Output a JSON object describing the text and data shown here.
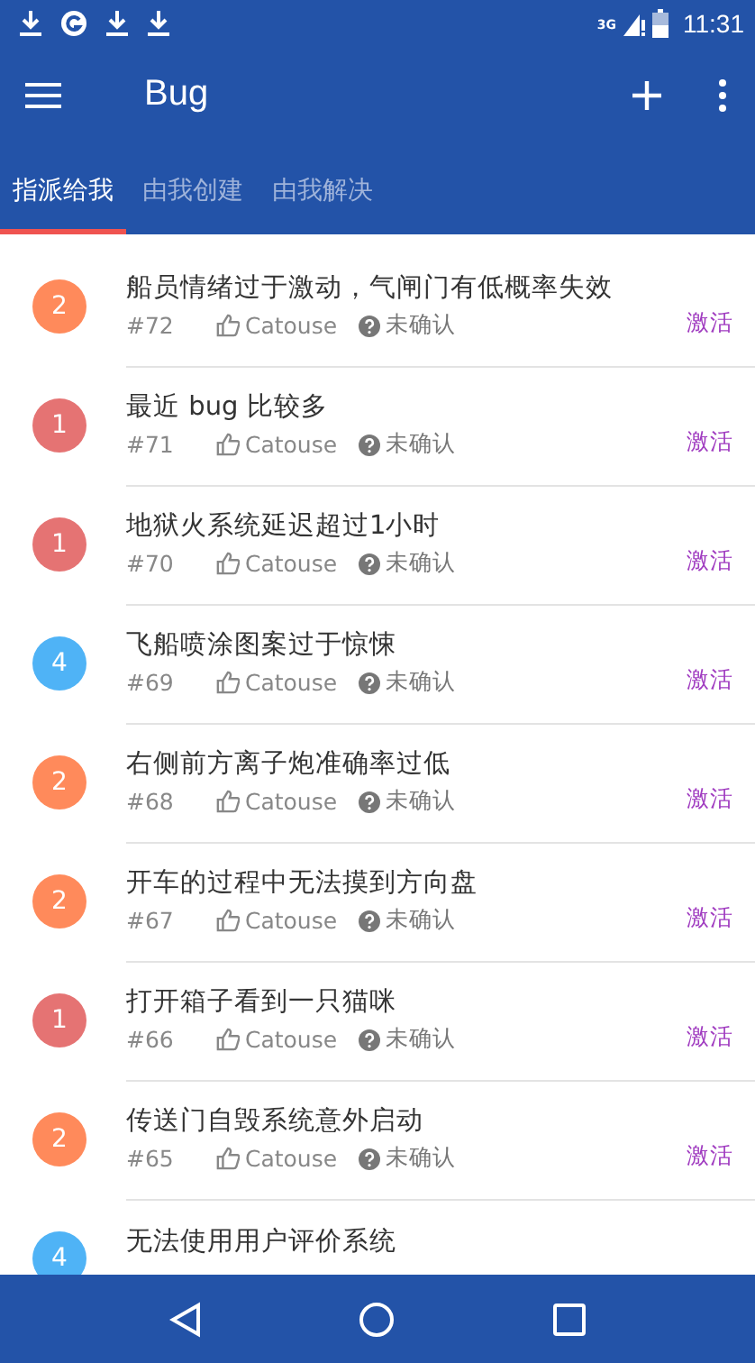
{
  "status_bar": {
    "network": "3G",
    "time": "11:31"
  },
  "app_bar": {
    "title": "Bug"
  },
  "tabs": [
    {
      "label": "指派给我",
      "selected": true
    },
    {
      "label": "由我创建",
      "selected": false
    },
    {
      "label": "由我解决",
      "selected": false
    }
  ],
  "bugs": [
    {
      "priority": "2",
      "color": "#ff8a5b",
      "title": "船员情绪过于激动，气闸门有低概率失效",
      "id": "#72",
      "assignee": "Catouse",
      "confirmation": "未确认",
      "status": "激活"
    },
    {
      "priority": "1",
      "color": "#e57373",
      "title": "最近 bug 比较多",
      "id": "#71",
      "assignee": "Catouse",
      "confirmation": "未确认",
      "status": "激活"
    },
    {
      "priority": "1",
      "color": "#e57373",
      "title": "地狱火系统延迟超过1小时",
      "id": "#70",
      "assignee": "Catouse",
      "confirmation": "未确认",
      "status": "激活"
    },
    {
      "priority": "4",
      "color": "#4fb3f6",
      "title": "飞船喷涂图案过于惊悚",
      "id": "#69",
      "assignee": "Catouse",
      "confirmation": "未确认",
      "status": "激活"
    },
    {
      "priority": "2",
      "color": "#ff8a5b",
      "title": "右侧前方离子炮准确率过低",
      "id": "#68",
      "assignee": "Catouse",
      "confirmation": "未确认",
      "status": "激活"
    },
    {
      "priority": "2",
      "color": "#ff8a5b",
      "title": "开车的过程中无法摸到方向盘",
      "id": "#67",
      "assignee": "Catouse",
      "confirmation": "未确认",
      "status": "激活"
    },
    {
      "priority": "1",
      "color": "#e57373",
      "title": "打开箱子看到一只猫咪",
      "id": "#66",
      "assignee": "Catouse",
      "confirmation": "未确认",
      "status": "激活"
    },
    {
      "priority": "2",
      "color": "#ff8a5b",
      "title": "传送门自毁系统意外启动",
      "id": "#65",
      "assignee": "Catouse",
      "confirmation": "未确认",
      "status": "激活"
    },
    {
      "priority": "4",
      "color": "#4fb3f6",
      "title": "无法使用用户评价系统"
    }
  ]
}
